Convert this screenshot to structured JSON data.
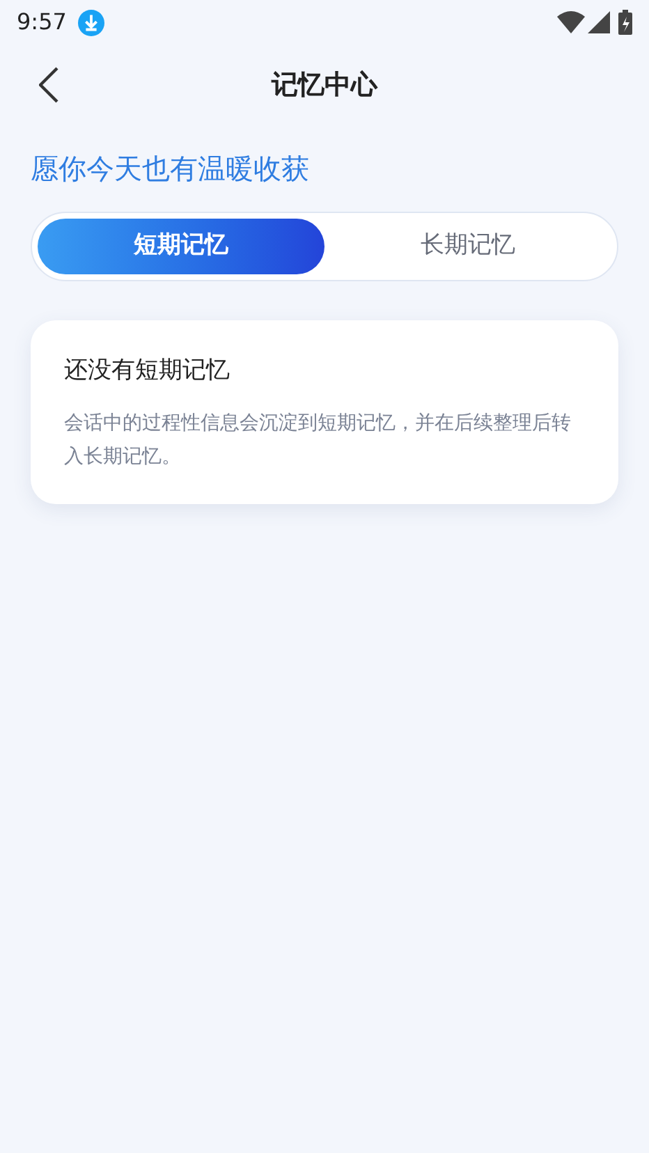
{
  "status_bar": {
    "time": "9:57"
  },
  "header": {
    "title": "记忆中心"
  },
  "greeting": "愿你今天也有温暖收获",
  "tabs": [
    {
      "label": "短期记忆",
      "selected": true
    },
    {
      "label": "长期记忆",
      "selected": false
    }
  ],
  "empty_card": {
    "title": "还没有短期记忆",
    "description": "会话中的过程性信息会沉淀到短期记忆，并在后续整理后转入长期记忆。"
  }
}
